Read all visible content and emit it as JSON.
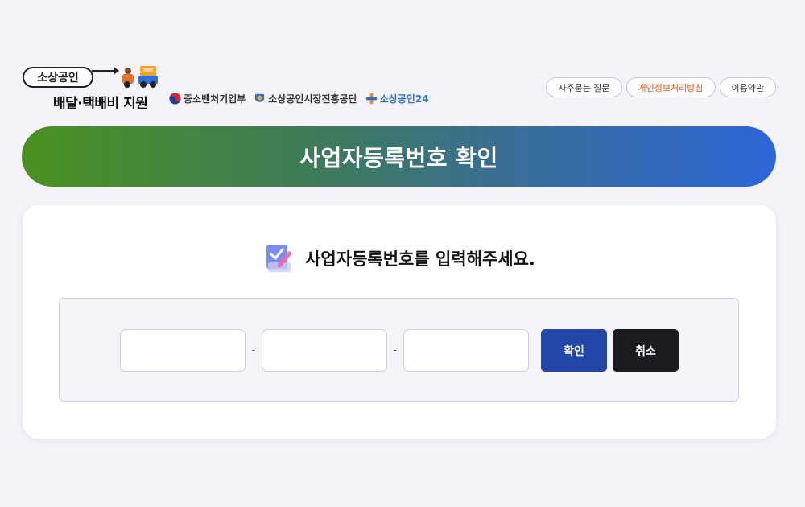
{
  "header": {
    "logo_top": "소상공인",
    "logo_bottom": "배달·택배비 지원",
    "partners": [
      {
        "name": "중소벤처기업부",
        "icon": "taegeuk-icon"
      },
      {
        "name": "소상공인시장진흥공단",
        "icon": "semas-icon"
      },
      {
        "name": "소상공인24",
        "icon": "plus-icon"
      }
    ],
    "nav": [
      {
        "label": "자주묻는 질문"
      },
      {
        "label": "개인정보처리방침"
      },
      {
        "label": "이용약관"
      }
    ]
  },
  "banner": {
    "title": "사업자등록번호 확인"
  },
  "form": {
    "prompt": "사업자등록번호를 입력해주세요.",
    "fields": [
      {
        "value": "",
        "placeholder": ""
      },
      {
        "value": "",
        "placeholder": ""
      },
      {
        "value": "",
        "placeholder": ""
      }
    ],
    "separator": "-",
    "confirm_label": "확인",
    "cancel_label": "취소"
  },
  "colors": {
    "banner_start": "#4a9120",
    "banner_end": "#2d66d8",
    "confirm_button": "#2347a8",
    "cancel_button": "#1c1c1e",
    "policy_link": "#e05a1c"
  }
}
